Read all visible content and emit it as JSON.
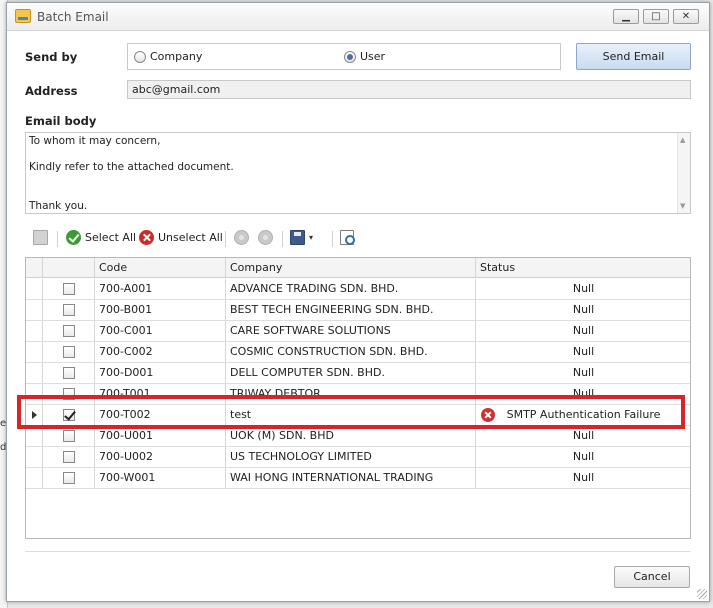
{
  "window": {
    "title": "Batch Email",
    "controls": {
      "minimize": "▁",
      "maximize": "□",
      "close": "✕"
    }
  },
  "form": {
    "send_by_label": "Send by",
    "options": [
      {
        "label": "Company",
        "selected": false
      },
      {
        "label": "User",
        "selected": true
      }
    ],
    "send_button": "Send Email",
    "address_label": "Address",
    "address_value": "abc@gmail.com",
    "email_body_label": "Email body",
    "email_body_lines": [
      "To whom it may concern,",
      "Kindly refer to the attached document.",
      "Thank you."
    ]
  },
  "toolbar": {
    "select_all": "Select All",
    "unselect_all": "Unselect All",
    "dropdown_glyph": "▾"
  },
  "grid": {
    "columns": [
      "Code",
      "Company",
      "Status"
    ],
    "rows": [
      {
        "checked": false,
        "code": "700-A001",
        "company": "ADVANCE TRADING SDN. BHD.",
        "status": "Null"
      },
      {
        "checked": false,
        "code": "700-B001",
        "company": "BEST TECH ENGINEERING SDN. BHD.",
        "status": "Null"
      },
      {
        "checked": false,
        "code": "700-C001",
        "company": "CARE SOFTWARE SOLUTIONS",
        "status": "Null"
      },
      {
        "checked": false,
        "code": "700-C002",
        "company": "COSMIC CONSTRUCTION SDN. BHD.",
        "status": "Null"
      },
      {
        "checked": false,
        "code": "700-D001",
        "company": "DELL COMPUTER SDN. BHD.",
        "status": "Null"
      },
      {
        "checked": false,
        "code": "700-T001",
        "company": "TRIWAY DEBTOR",
        "status": "Null"
      },
      {
        "checked": true,
        "code": "700-T002",
        "company": "test",
        "status": "SMTP Authentication Failure",
        "error": true,
        "current": true
      },
      {
        "checked": false,
        "code": "700-U001",
        "company": "UOK (M) SDN. BHD",
        "status": "Null"
      },
      {
        "checked": false,
        "code": "700-U002",
        "company": "US TECHNOLOGY LIMITED",
        "status": "Null"
      },
      {
        "checked": false,
        "code": "700-W001",
        "company": "WAI HONG INTERNATIONAL TRADING",
        "status": "Null"
      }
    ]
  },
  "footer": {
    "cancel_button": "Cancel"
  },
  "background_fragments": [
    "e c",
    "de"
  ],
  "colors": {
    "highlight": "#d8232a",
    "error": "#d23030",
    "accent": "#c9daf0"
  }
}
